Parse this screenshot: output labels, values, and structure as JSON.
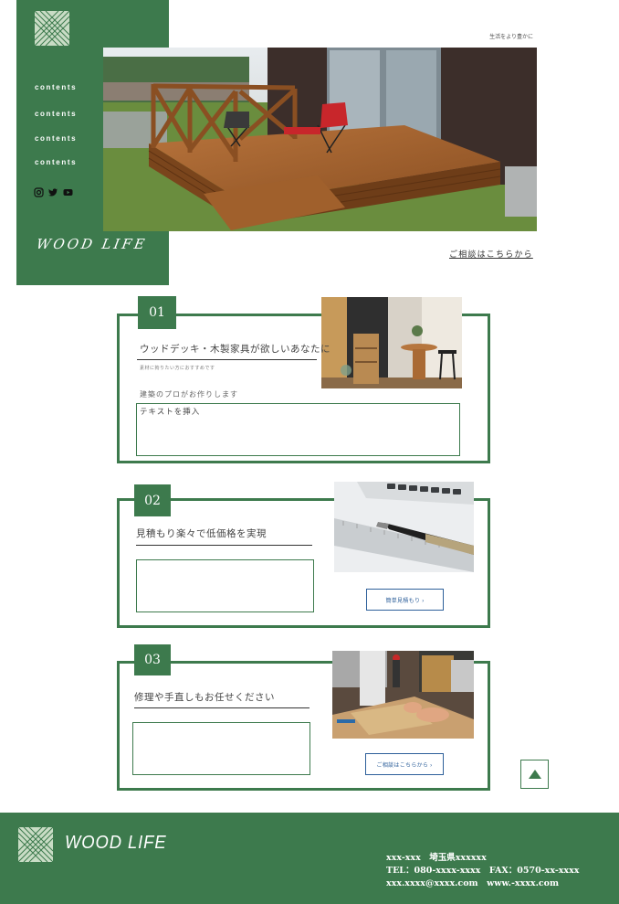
{
  "sidebar": {
    "nav": [
      "contents",
      "contents",
      "contents",
      "contents"
    ],
    "social_icons": [
      "instagram-icon",
      "twitter-icon",
      "youtube-icon"
    ],
    "brand": "WOOD LIFE"
  },
  "hero": {
    "tagline": "生活をより豊かに",
    "consult_link": "ご相談はこちらから",
    "image": "wood-deck-photo"
  },
  "cards": [
    {
      "number": "01",
      "title": "ウッドデッキ・木製家具が欲しいあなたに",
      "subtitle_small": "素材に拘りたい方におすすめです",
      "subtitle": "建築のプロがお作りします",
      "textbox": "テキストを挿入",
      "image": "interior-furniture-photo"
    },
    {
      "number": "02",
      "title": "見積もり楽々で低価格を実現",
      "textbox": "",
      "button": "簡単見積もり ›",
      "image": "calculator-pen-photo"
    },
    {
      "number": "03",
      "title": "修理や手直しもお任せください",
      "textbox": "",
      "button": "ご相談はこちらから ›",
      "image": "carpenter-work-photo"
    }
  ],
  "footer": {
    "brand": "WOOD LIFE",
    "address": "xxx-xxx　埼玉県xxxxxx",
    "phone": "TEL：080-xxxx-xxxx　FAX：0570-xx-xxxx",
    "web": "xxx.xxxx@xxxx.com　www.-xxxx.com"
  },
  "colors": {
    "accent": "#3d7a4d",
    "button": "#2d5f9a"
  }
}
